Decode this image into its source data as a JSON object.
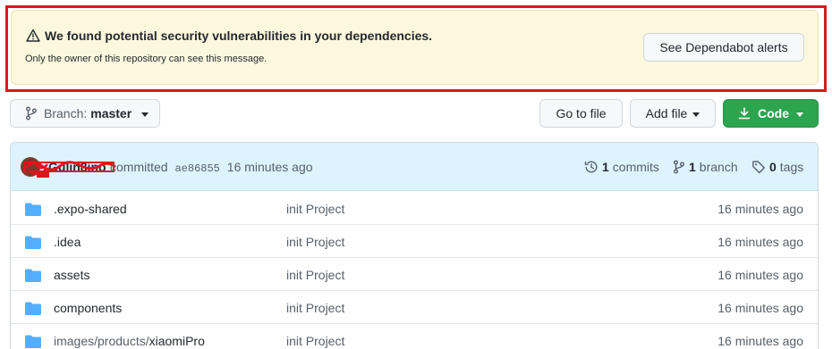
{
  "alert": {
    "title": "We found potential security vulnerabilities in your dependencies.",
    "subtitle": "Only the owner of this repository can see this message.",
    "button": "See Dependabot alerts"
  },
  "toolbar": {
    "branch_label": "Branch:",
    "branch_name": "master",
    "goto_file": "Go to file",
    "add_file": "Add file",
    "code": "Code"
  },
  "commit": {
    "author": "Gulin8ino",
    "action": "committed",
    "sha": "ae86855",
    "time": "16 minutes ago",
    "commits_count": "1",
    "commits_label": "commits",
    "branch_count": "1",
    "branch_label": "branch",
    "tags_count": "0",
    "tags_label": "tags"
  },
  "files": [
    {
      "name": ".expo-shared",
      "message": "init Project",
      "age": "16 minutes ago"
    },
    {
      "name": ".idea",
      "message": "init Project",
      "age": "16 minutes ago"
    },
    {
      "name": "assets",
      "message": "init Project",
      "age": "16 minutes ago"
    },
    {
      "name": "components",
      "message": "init Project",
      "age": "16 minutes ago"
    },
    {
      "name_prefix": "images/products/",
      "name": "xiaomiPro",
      "message": "init Project",
      "age": "16 minutes ago"
    }
  ],
  "colors": {
    "alert_bg": "#fcf8dd",
    "highlight_outline": "#d21c1c",
    "code_button": "#2da44e",
    "folder": "#54aeff",
    "header_bg": "#ddf4ff"
  },
  "icons": [
    "alert-icon",
    "git-branch-icon",
    "caret-down-icon",
    "download-icon",
    "history-icon",
    "tag-icon",
    "folder-icon"
  ]
}
